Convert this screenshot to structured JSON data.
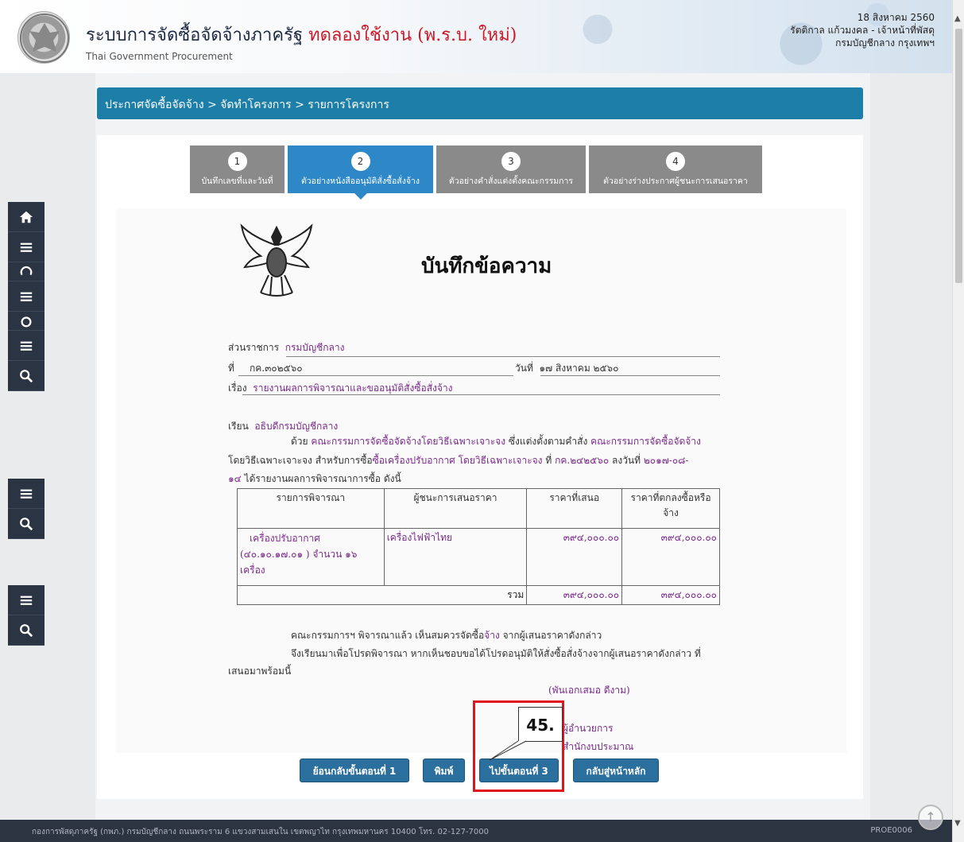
{
  "header": {
    "title_main": "ระบบการจัดซื้อจัดจ้างภาครัฐ",
    "title_trial": "ทดลองใช้งาน (พ.ร.บ. ใหม่)",
    "subtitle": "Thai Government Procurement",
    "date": "18 สิงหาคม 2560",
    "user": "รัตติกาล แก้วมงคล - เจ้าหน้าที่พัสดุ",
    "org": "กรมบัญชีกลาง กรุงเทพฯ"
  },
  "breadcrumb": "ประกาศจัดซื้อจัดจ้าง > จัดทำโครงการ > รายการโครงการ",
  "steps": [
    {
      "num": "1",
      "label": "บันทึกเลขที่และวันที่",
      "active": false
    },
    {
      "num": "2",
      "label": "ตัวอย่างหนังสืออนุมัติสั่งซื้อสั่งจ้าง",
      "active": true
    },
    {
      "num": "3",
      "label": "ตัวอย่างคำสั่งแต่งตั้งคณะกรรมการ",
      "active": false
    },
    {
      "num": "4",
      "label": "ตัวอย่างร่างประกาศผู้ชนะการเสนอราคา",
      "active": false
    }
  ],
  "document": {
    "title": "บันทึกข้อความ",
    "dept_label": "ส่วนราชการ",
    "dept_value": "กรมบัญชีกลาง",
    "no_label": "ที่",
    "no_value": "กค.๓๐๒๕๖๐",
    "date_label": "วันที่",
    "date_value": "๑๗ สิงหาคม ๒๕๖๐",
    "subject_label": "เรื่อง",
    "subject_value": "รายงานผลการพิจารณาและขออนุมัติสั่งซื้อสั่งจ้าง",
    "to_label": "เรียน",
    "to_value": "อธิบดีกรมบัญชีกลาง",
    "body_line1_a": "ด้วย",
    "body_line1_b": "คณะกรรมการจัดซื้อจัดจ้างโดยวิธีเฉพาะเจาะจง",
    "body_line1_c": "ซึ่งแต่งตั้งตามคำสั่ง",
    "body_line1_d": "คณะกรรมการจัดซื้อจัดจ้าง",
    "body_line2_a": "โดยวิธีเฉพาะเจาะจง สำหรับการซื้อ",
    "body_line2_b": "ซื้อเครื่องปรับอากาศ โดยวิธีเฉพาะเจาะจง",
    "body_line2_c": "ที่",
    "body_line2_d": "กค.๒๔๒๕๖๐",
    "body_line2_e": "ลงวันที่",
    "body_line2_f": "๒๐๑๗-๐๘-",
    "body_line3_a": "๑๔",
    "body_line3_b": "ได้รายงานผลการพิจารณาการซื้อ ดังนี้",
    "conclusion_1a": "คณะกรรมการฯ พิจารณาแล้ว เห็นสมควรจัดซื้อ",
    "conclusion_1b": "จ้าง",
    "conclusion_1c": "จากผู้เสนอราคาดังกล่าว",
    "conclusion_2": "จึงเรียนมาเพื่อโปรดพิจารณา หากเห็นชอบขอได้โปรดอนุมัติให้สั่งซื้อสั่งจ้างจากผู้เสนอราคาดังกล่าว ที่",
    "conclusion_3": "เสนอมาพร้อมนี้",
    "signer": "(พันเอกเสมอ ดีงาม)",
    "signer_pos1": "ผู้อำนวยการ",
    "signer_pos2": "สำนักงบประมาณ"
  },
  "table": {
    "headers": [
      "รายการพิจารณา",
      "ผู้ชนะการเสนอราคา",
      "ราคาที่เสนอ",
      "ราคาที่ตกลงซื้อหรือจ้าง"
    ],
    "row": {
      "item_line1": "เครื่องปรับอากาศ",
      "item_line2": "(๔๐.๑๐.๑๗.๐๑ ) จำนวน ๑๖",
      "item_line3": "เครื่อง",
      "winner": "เครื่องไฟฟ้าไทย",
      "offer": "๓๙๔,๐๐๐.๐๐",
      "agreed": "๓๙๔,๐๐๐.๐๐"
    },
    "total_label": "รวม",
    "total_offer": "๓๙๔,๐๐๐.๐๐",
    "total_agreed": "๓๙๔,๐๐๐.๐๐"
  },
  "buttons": {
    "back": "ย้อนกลับขั้นตอนที่ 1",
    "print": "พิมพ์",
    "next": "ไปขั้นตอนที่ 3",
    "home": "กลับสู่หน้าหลัก"
  },
  "annotation": "45.",
  "footer": {
    "address": "กองการพัสดุภาครัฐ (กพภ.) กรมบัญชีกลาง ถนนพระราม 6 แขวงสามเสนใน เขตพญาไท กรุงเทพมหานคร 10400 โทร. 02-127-7000",
    "code": "PROE0006"
  },
  "colors": {
    "accent": "#2a6f9e",
    "breadcrumb": "#1d7ea7",
    "active_step": "#2e88c8",
    "value_text": "#7a2a8a",
    "trial_red": "#cc1b2a",
    "callout_red": "#e0141c"
  },
  "dock_icons": [
    "home-icon",
    "menu-icon",
    "refresh-icon",
    "menu-icon",
    "circle-icon",
    "menu-icon",
    "search-icon",
    "menu-icon",
    "search-icon",
    "menu-icon",
    "search-icon"
  ]
}
